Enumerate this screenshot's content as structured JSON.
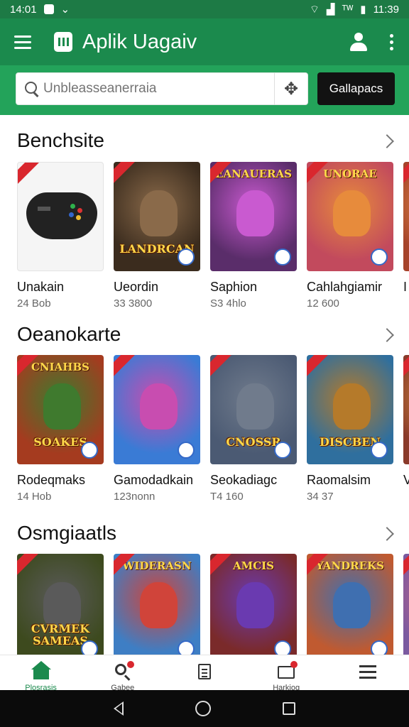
{
  "status_bar": {
    "time_left": "14:01",
    "time_right": "11:39",
    "net_label": "ᵀᵂ"
  },
  "app_bar": {
    "title": "Aplik Uagaiv"
  },
  "search": {
    "placeholder": "Unbleasseanerraia",
    "gallery_label": "Gallapacs"
  },
  "sections": [
    {
      "title": "Benchsite",
      "items": [
        {
          "name": "Unakain",
          "meta": "24 Bob",
          "art": {
            "bg": "#f5f5f5",
            "style": "gamepad"
          }
        },
        {
          "name": "Ueordin",
          "meta": "33 3800",
          "art": {
            "bg": "#3b2c1e",
            "top": "",
            "label": "LANDRCAN",
            "accent": "#8a6a4a"
          }
        },
        {
          "name": "Saphion",
          "meta": "S3 4hlo",
          "art": {
            "bg": "#5a2d6a",
            "top": "EANAUERAS",
            "label": "",
            "accent": "#c95ad0"
          }
        },
        {
          "name": "Cahlahgiamir",
          "meta": "12 600",
          "art": {
            "bg": "#c24a5d",
            "top": "UNORAE",
            "label": "",
            "accent": "#e78b3c"
          }
        },
        {
          "name": "I",
          "meta": "",
          "art": {
            "bg": "#a6432a",
            "top": "",
            "label": "",
            "accent": "#f0a050"
          }
        }
      ]
    },
    {
      "title": "Oeanokarte",
      "items": [
        {
          "name": "Rodeqmaks",
          "meta": "14 Hob",
          "art": {
            "bg": "#a53b1f",
            "top": "CNIAHBS",
            "label": "SOAKES",
            "accent": "#3f7a2e"
          }
        },
        {
          "name": "Gamodadkain",
          "meta": "123nonn",
          "art": {
            "bg": "#3a7bd5",
            "top": "",
            "label": "",
            "accent": "#c84db0"
          }
        },
        {
          "name": "Seokadiagc",
          "meta": "T4 160",
          "art": {
            "bg": "#4b5a73",
            "top": "",
            "label": "CNOSSR",
            "accent": "#707b8c"
          }
        },
        {
          "name": "Raomalsim",
          "meta": "34 37",
          "art": {
            "bg": "#2f6f9e",
            "top": "",
            "label": "DISCBEN",
            "accent": "#b57a2a"
          }
        },
        {
          "name": "V",
          "meta": "",
          "art": {
            "bg": "#8a3a2a",
            "top": "",
            "label": "",
            "accent": "#e0a040"
          }
        }
      ]
    },
    {
      "title": "Osmgiaatls",
      "items": [
        {
          "name": "",
          "meta": "",
          "art": {
            "bg": "#3d4a1e",
            "top": "",
            "label": "CVRMEK SAMEAS",
            "accent": "#5a5a5a"
          }
        },
        {
          "name": "",
          "meta": "",
          "art": {
            "bg": "#3e7ec4",
            "top": "WIDERASN",
            "label": "",
            "accent": "#d0443a"
          }
        },
        {
          "name": "",
          "meta": "",
          "art": {
            "bg": "#7a2a2a",
            "top": "AMCIS",
            "label": "",
            "accent": "#6a3ab0"
          }
        },
        {
          "name": "",
          "meta": "",
          "art": {
            "bg": "#c05a30",
            "top": "YANDREKS",
            "label": "",
            "accent": "#3f6fb0"
          }
        },
        {
          "name": "",
          "meta": "",
          "art": {
            "bg": "#7a5aa0",
            "top": "",
            "label": "",
            "accent": "#d06080"
          }
        }
      ]
    }
  ],
  "bottom_nav": [
    {
      "label": "Plosrasis",
      "icon": "home-icon",
      "active": true
    },
    {
      "label": "Gabee",
      "icon": "search-icon",
      "badge": true
    },
    {
      "label": "",
      "icon": "clipboard-icon"
    },
    {
      "label": "Harkiog",
      "icon": "mail-icon",
      "badge": true
    },
    {
      "label": "",
      "icon": "list-icon"
    }
  ],
  "colors": {
    "brand": "#1b8a4d",
    "search_band": "#23a35a",
    "status_bar": "#1d7a45",
    "badge": "#d9272e"
  }
}
